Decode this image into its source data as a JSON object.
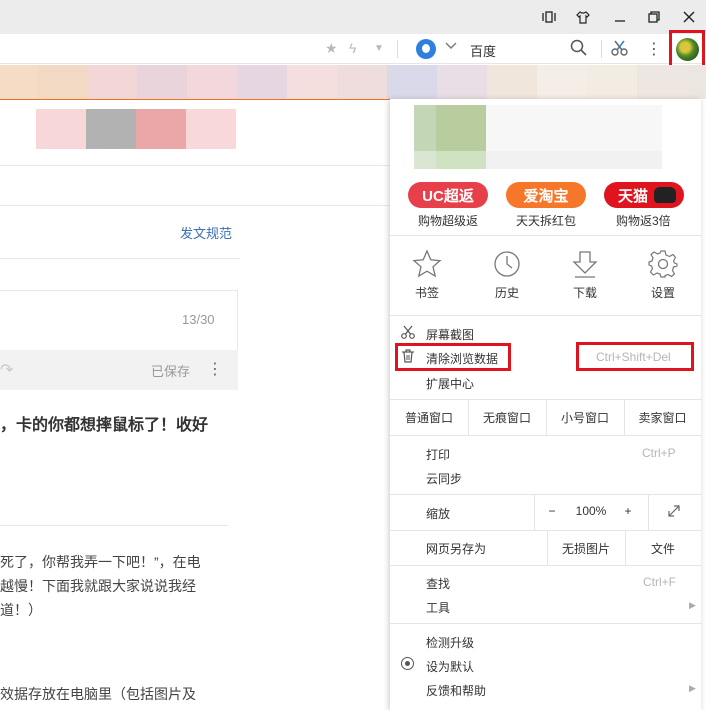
{
  "browser": {
    "search_engine_name": "百度",
    "avatar_label": "user avatar"
  },
  "page": {
    "publish_rules": "发文规范",
    "counter": "13/30",
    "saved": "已保存",
    "more": "⋮",
    "headline": "，卡的你都想摔鼠标了！收好",
    "body_line1": "死了，你帮我弄一下吧！”，在电",
    "body_line2": "越慢！下面我就跟大家说说我经",
    "body_line3": "道！）",
    "body_line4": "效据存放在电脑里（包括图片及"
  },
  "menu": {
    "promos": [
      {
        "label": "UC超返",
        "caption": "购物超级返",
        "color": "#e8404a"
      },
      {
        "label": "爱淘宝",
        "caption": "天天拆红包",
        "color": "#f6772a"
      },
      {
        "label": "天猫",
        "caption": "购物返3倍",
        "color": "#e0141e"
      }
    ],
    "tools": [
      {
        "label": "书签",
        "icon": "star-icon"
      },
      {
        "label": "历史",
        "icon": "clock-icon"
      },
      {
        "label": "下载",
        "icon": "download-icon"
      },
      {
        "label": "设置",
        "icon": "gear-icon"
      }
    ],
    "screenshot": "屏幕截图",
    "clear_data": "清除浏览数据",
    "clear_data_shortcut": "Ctrl+Shift+Del",
    "extensions": "扩展中心",
    "windows": [
      "普通窗口",
      "无痕窗口",
      "小号窗口",
      "卖家窗口"
    ],
    "print": "打印",
    "print_shortcut": "Ctrl+P",
    "cloud_sync": "云同步",
    "zoom": "缩放",
    "zoom_minus": "−",
    "zoom_value": "100%",
    "zoom_plus": "+",
    "save_page_as": "网页另存为",
    "lossless_image": "无损图片",
    "file": "文件",
    "find": "查找",
    "find_shortcut": "Ctrl+F",
    "tools_item": "工具",
    "check_update": "检测升级",
    "set_default": "设为默认",
    "feedback": "反馈和帮助"
  },
  "colors": {
    "highlight": "#e0141e",
    "accent": "#f0701e"
  }
}
